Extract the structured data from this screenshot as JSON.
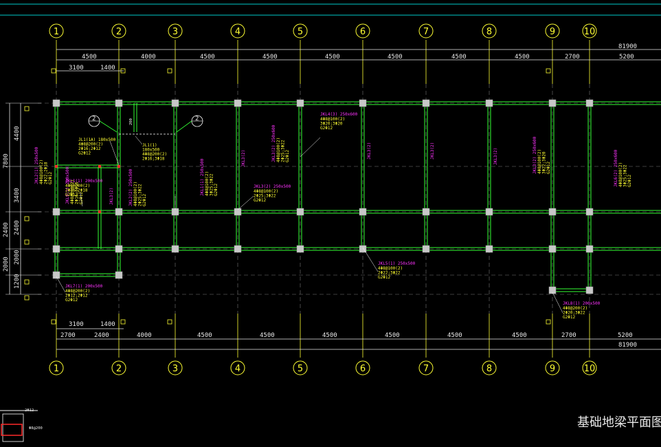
{
  "drawing": {
    "title": "基础地梁平面图",
    "axes": [
      "1",
      "2",
      "3",
      "4",
      "5",
      "6",
      "7",
      "8",
      "9",
      "10"
    ],
    "section_marks": [
      "2",
      "2"
    ],
    "top_dims_row1": [
      "4500",
      "4000",
      "4500",
      "4500",
      "4500",
      "4500",
      "4500",
      "4500",
      "2700",
      "5200"
    ],
    "top_total": "81900",
    "top_dims_row2": [
      "3100",
      "1400"
    ],
    "bottom_dims_row1": [
      "2700",
      "2400",
      "4000",
      "4500",
      "4500",
      "4500",
      "4500",
      "4500",
      "4500",
      "2700",
      "5200"
    ],
    "bottom_total": "81900",
    "bottom_dims_row2": [
      "3100",
      "1400"
    ],
    "left_dims_outer": [
      "7800",
      "2400",
      "2000"
    ],
    "left_dims_inner": [
      "4400",
      "3400",
      "2400",
      "2000",
      "1200"
    ],
    "colors": {
      "background": "#000000",
      "beam": "#33ff33",
      "column": "#c8c8c8",
      "axis": "#ffff33",
      "magenta": "#ff33ff",
      "dimension": "#e8e8e8",
      "cyan": "#00c8c8"
    }
  },
  "annotations": [
    {
      "id": "a1",
      "mag": "",
      "yel": "JL1(1A) 180x500\n4Φ8@200(2)\n2Φ16;2Φ12\nG2Φ12"
    },
    {
      "id": "a2",
      "mag": "",
      "yel": "JL1(1)\n180x500\n4Φ8@200(2)\n2Φ16;3Φ18"
    },
    {
      "id": "a3",
      "mag": "JKL2(1) 250x500",
      "yel": "4Φ8@100(2)\n2Φ22;2Φ18\nG2Φ12"
    },
    {
      "id": "a4",
      "mag": "JKL4(3) 250x600",
      "yel": "4Φ8@100(2)\n3Φ20;3Φ20\nG2Φ12"
    },
    {
      "id": "a5",
      "mag": "JKL3(2) 250x500",
      "yel": "4Φ8@100(2)\n2Φ25;3Φ22\nG2Φ12"
    },
    {
      "id": "a6",
      "mag": "JKL3(2) 250x600",
      "yel": "4Φ8@100(2)\n2Φ25;3Φ22\nG2Φ12"
    },
    {
      "id": "a7",
      "mag": "JKL3(2)",
      "yel": ""
    },
    {
      "id": "a8",
      "mag": "JKL5(1) 250x500",
      "yel": "4Φ8@100(2)\n2Φ22;3Φ22\nG2Φ12"
    },
    {
      "id": "a9",
      "mag": "JKL3(2) 250x600",
      "yel": "4Φ8@100(2)\n3Φ22;3Φ20\nG2Φ12"
    },
    {
      "id": "a10",
      "mag": "JKL6(2) 250x600",
      "yel": "4Φ8@100(2)\n3Φ25;3Φ22\nG2Φ12"
    },
    {
      "id": "a11",
      "mag": "JKL1(1) 250x500",
      "yel": "4Φ8@100(2)\n3Φ25;3Φ22\nG2Φ12"
    },
    {
      "id": "a12",
      "mag": "JKL7(1) 200x500",
      "yel": "4Φ8@200(2)\n2Φ12;2Φ12\nG2Φ12"
    },
    {
      "id": "a13",
      "mag": "JKL8(1) 200x500",
      "yel": "4Φ8@200(2)\n2Φ20;3Φ22\nG2Φ12"
    },
    {
      "id": "a14",
      "mag": "JKL2(2) 250x500",
      "yel": "4Φ8@100(2)\n2Φ25;3Φ22\nG2Φ12"
    },
    {
      "id": "a15",
      "mag": "JKL9(1) 200x500",
      "yel": "4Φ8@200(2)\n2Φ16;3Φ16\nG2Φ12"
    },
    {
      "id": "a16",
      "mag": "JKL1(1) 200x500",
      "yel": "4Φ8@200(2)\n2Φ16;2Φ18\nG2Φ12"
    },
    {
      "id": "a17",
      "mag": "JKL3(2)",
      "yel": ""
    },
    {
      "id": "a18",
      "mag": "JKL3(2)",
      "yel": ""
    },
    {
      "id": "a19",
      "mag": "JKL3(2)",
      "yel": ""
    },
    {
      "id": "a20",
      "mag": "JKL3(2)",
      "yel": ""
    }
  ],
  "misc": {
    "dim_200": "200",
    "stub_label": "3Φ20 ... 2Φ8@200",
    "legend_bottom": "2Φ12",
    "legend_right": "Φ8@200"
  }
}
